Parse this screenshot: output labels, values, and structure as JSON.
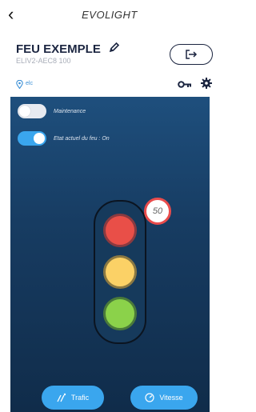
{
  "app": {
    "title": "EVOLIGHT"
  },
  "device": {
    "name": "FEU EXEMPLE",
    "id": "ELIV2-AEC8 100",
    "location": "elc"
  },
  "controls": {
    "maintenance": {
      "label": "Maintenance",
      "on": false
    },
    "state": {
      "label": "Etat actuel du feu : On",
      "on": true
    }
  },
  "speed_limit": "50",
  "buttons": {
    "trafic": "Trafic",
    "vitesse": "Vitesse"
  },
  "colors": {
    "accent": "#3aa6ee",
    "red": "#e94f48",
    "yellow": "#fbd166",
    "green": "#8bd24a",
    "panel": "#173c62"
  },
  "icons": [
    "chevron-left-icon",
    "pencil-icon",
    "logout-icon",
    "location-pin-icon",
    "key-icon",
    "gear-icon",
    "traffic-icon",
    "speedometer-icon"
  ]
}
